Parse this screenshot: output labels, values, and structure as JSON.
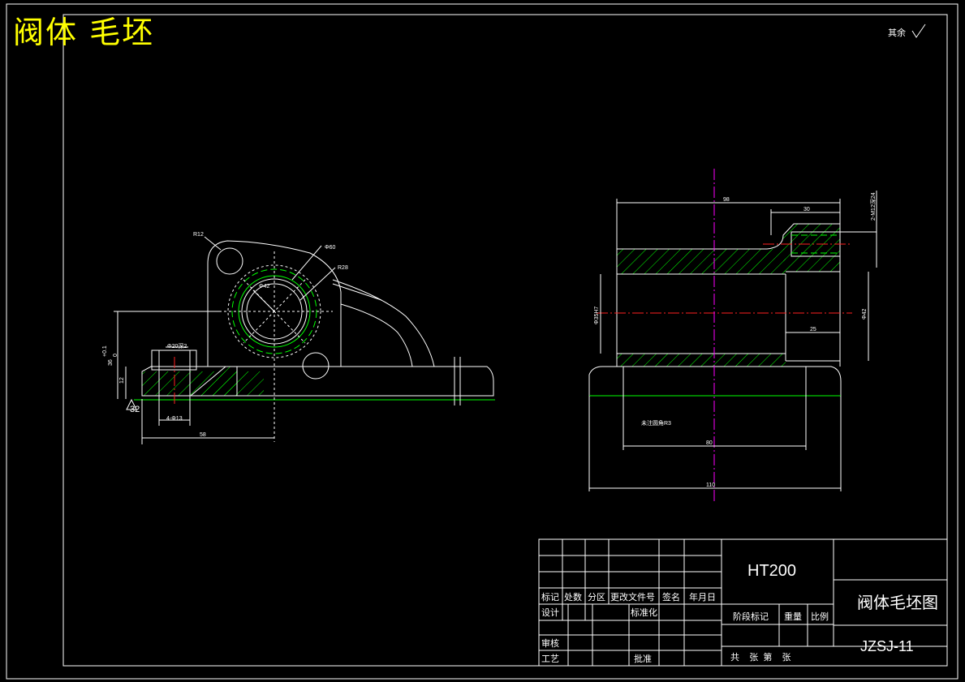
{
  "drawing_title": "阀体 毛坯",
  "roughness_note": "其余",
  "front_view": {
    "dim_r12": "R12",
    "dim_phi60": "Φ60",
    "dim_r28": "R28",
    "dim_phi42": "Φ42",
    "dim_boss": "Φ20深2",
    "dim_holes": "4-Φ13",
    "dim_height": "36",
    "dim_tol_upper": "+0.1",
    "dim_tol_lower": "0",
    "dim_12": "12",
    "dim_58": "58",
    "dim_roughness": "32"
  },
  "side_view": {
    "dim_98": "98",
    "dim_30": "30",
    "dim_thread": "2-M12深24",
    "dim_bore": "Φ35H7",
    "dim_phi42": "Φ42",
    "dim_25": "25",
    "dim_80": "80",
    "dim_110": "110",
    "fillet_note": "未注圆角R3"
  },
  "title_block": {
    "material": "HT200",
    "part_name": "阀体毛坯图",
    "drawing_no": "JZSJ-11",
    "hdr_mark": "标记",
    "hdr_count": "处数",
    "hdr_zone": "分区",
    "hdr_doc": "更改文件号",
    "hdr_sign": "签名",
    "hdr_date": "年月日",
    "design": "设计",
    "standardize": "标准化",
    "stage_mark": "阶段标记",
    "weight": "重量",
    "scale": "比例",
    "review": "审核",
    "process": "工艺",
    "approve": "批准",
    "sheets": "共    张  第    张"
  },
  "colors": {
    "outline": "#ffffff",
    "hatch": "#00ff00",
    "center_line": "#ff2020",
    "axis_line": "#ff00ff",
    "title_text": "#ffff00"
  }
}
